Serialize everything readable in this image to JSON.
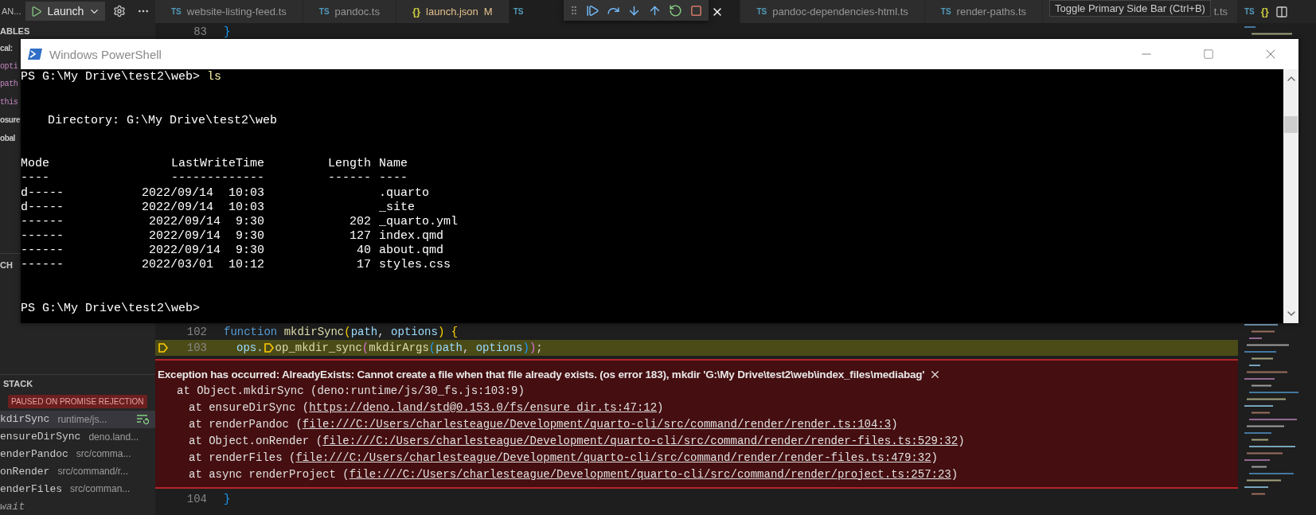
{
  "sidebar": {
    "title": "AN...",
    "config": "Launch",
    "variables": {
      "header": "ABLES",
      "items": [
        {
          "kind": "scope",
          "label": "cal:"
        },
        {
          "kind": "variable",
          "label": "opti"
        },
        {
          "kind": "variable",
          "label": "path"
        },
        {
          "kind": "variable",
          "label": "this"
        },
        {
          "kind": "scope",
          "label": "osure"
        },
        {
          "kind": "scope",
          "label": "obal"
        }
      ]
    },
    "watch": {
      "header": "CH"
    },
    "call_stack": {
      "header": "STACK",
      "status": "PAUSED ON PROMISE REJECTION",
      "frames": [
        {
          "kind": "frame",
          "name": "kdirSync",
          "source": "runtime/js...",
          "selected": true
        },
        {
          "kind": "frame",
          "name": "ensureDirSync",
          "source": "deno.land...",
          "selected": false
        },
        {
          "kind": "frame",
          "name": "enderPandoc",
          "source": "src/comma...",
          "selected": false
        },
        {
          "kind": "frame",
          "name": "onRender",
          "source": "src/command/r...",
          "selected": false
        },
        {
          "kind": "frame",
          "name": "enderFiles",
          "source": "src/comman...",
          "selected": false
        },
        {
          "kind": "label",
          "name": "wait",
          "selected": false
        }
      ]
    }
  },
  "tabs": [
    {
      "kind": "ts",
      "icon": "TS",
      "label": "website-listing-feed.ts",
      "selected": false
    },
    {
      "kind": "ts",
      "icon": "TS",
      "label": "pandoc.ts",
      "selected": false
    },
    {
      "kind": "json",
      "icon": "{}",
      "label": "launch.json",
      "modified": "M",
      "selected": false
    },
    {
      "kind": "ts",
      "icon": "TS",
      "selected": true
    },
    {
      "kind": "ts",
      "icon": "TS",
      "label": "pandoc-dependencies-html.ts",
      "selected": false
    },
    {
      "kind": "ts",
      "icon": "TS",
      "label": "render-paths.ts",
      "selected": false
    },
    {
      "label": "t.ts",
      "selected": false
    }
  ],
  "side_tabs": [
    {
      "kind": "ts",
      "icon": "TS"
    },
    {
      "kind": "json",
      "icon": "{}"
    }
  ],
  "tooltip": "Toggle Primary Side Bar (Ctrl+B)",
  "editor": {
    "top_line": {
      "number": "83",
      "parts": [
        {
          "tokens": [
            {
              "kind": "bracket3",
              "text": "}"
            }
          ]
        }
      ]
    },
    "lines": [
      {
        "number": "102",
        "paused": false,
        "parts": [
          {
            "tokens": [
              {
                "kind": "keyword",
                "text": "function "
              },
              {
                "kind": "function",
                "text": "mkdirSync"
              },
              {
                "kind": "bracket1",
                "text": "("
              },
              {
                "kind": "variable",
                "text": "path"
              },
              {
                "kind": "plain",
                "text": ", "
              },
              {
                "kind": "variable",
                "text": "options"
              },
              {
                "kind": "bracket1",
                "text": ")"
              },
              {
                "kind": "bracket1",
                "text": " {"
              }
            ]
          }
        ]
      },
      {
        "number": "103",
        "paused": true,
        "parts": [
          {
            "tokens": [
              {
                "kind": "variable",
                "text": "ops."
              }
            ]
          },
          {
            "stop": true,
            "tokens": [
              {
                "kind": "function",
                "text": "op_mkdir_sync"
              },
              {
                "kind": "bracket2",
                "text": "("
              },
              {
                "kind": "function",
                "text": "mkdirArgs"
              },
              {
                "kind": "bracket3",
                "text": "("
              },
              {
                "kind": "variable",
                "text": "path"
              },
              {
                "kind": "plain",
                "text": ", "
              },
              {
                "kind": "variable",
                "text": "options"
              },
              {
                "kind": "bracket3",
                "text": ")"
              },
              {
                "kind": "bracket2",
                "text": ")"
              },
              {
                "kind": "plain",
                "text": ";"
              }
            ]
          }
        ]
      }
    ],
    "exception": {
      "message": "Exception has occurred: AlreadyExists: Cannot create a file when that file already exists. (os error 183), mkdir 'G:\\My Drive\\test2\\web\\index_files\\mediabag'",
      "frames": [
        {
          "text": "at Object.mkdirSync (deno:runtime/js/30_fs.js:103:9)"
        },
        {
          "text": "at ensureDirSync (",
          "link": "https://deno.land/std@0.153.0/fs/ensure_dir.ts:47:12",
          "suffix": ")"
        },
        {
          "text": "at renderPandoc (",
          "link": "file:///C:/Users/charlesteague/Development/quarto-cli/src/command/render/render.ts:104:3",
          "suffix": ")"
        },
        {
          "text": "at Object.onRender (",
          "link": "file:///C:/Users/charlesteague/Development/quarto-cli/src/command/render/render-files.ts:529:32",
          "suffix": ")"
        },
        {
          "text": "at renderFiles (",
          "link": "file:///C:/Users/charlesteague/Development/quarto-cli/src/command/render/render-files.ts:479:32",
          "suffix": ")"
        },
        {
          "text": "at async renderProject (",
          "link": "file:///C:/Users/charlesteague/Development/quarto-cli/src/command/render/project.ts:257:23",
          "suffix": ")"
        }
      ]
    },
    "bottom_line": {
      "number": "104",
      "parts": [
        {
          "tokens": [
            {
              "kind": "bracket3",
              "text": "}"
            }
          ]
        }
      ]
    }
  },
  "terminal": {
    "title": "Windows PowerShell",
    "prompt": "PS G:\\My Drive\\test2\\web>",
    "command": "ls",
    "directory": "Directory: G:\\My Drive\\test2\\web",
    "columns": [
      "Mode",
      "LastWriteTime",
      "Length",
      "Name"
    ],
    "underlines": [
      "----",
      "-------------",
      "------",
      "----"
    ],
    "rows": [
      [
        "d-----",
        "2022/09/14 10:03",
        "",
        ".quarto"
      ],
      [
        "d-----",
        "2022/09/14 10:03",
        "",
        "_site"
      ],
      [
        "------",
        "2022/09/14 9:30",
        "202",
        "_quarto.yml"
      ],
      [
        "------",
        "2022/09/14 9:30",
        "127",
        "index.qmd"
      ],
      [
        "------",
        "2022/09/14 9:30",
        "40",
        "about.qmd"
      ],
      [
        "------",
        "2022/03/01 10:12",
        "17",
        "styles.css"
      ]
    ],
    "final_prompt": "PS G:\\My Drive\\test2\\web>"
  }
}
